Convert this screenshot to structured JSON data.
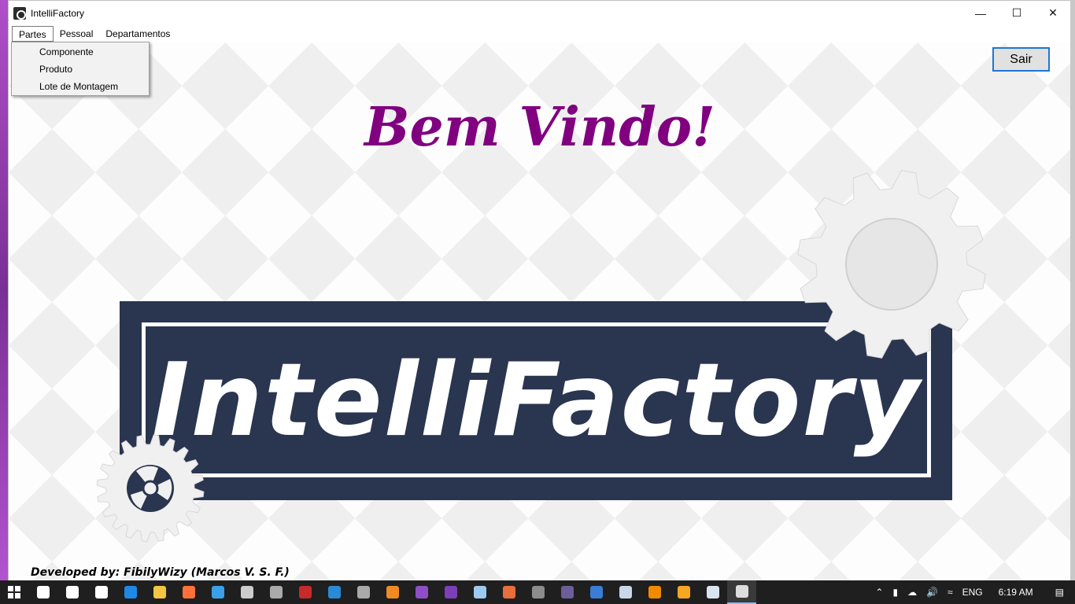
{
  "window": {
    "title": "IntelliFactory",
    "controls": [
      "minimize-icon",
      "maximize-icon",
      "close-icon"
    ]
  },
  "menubar": {
    "items": [
      {
        "label": "Partes",
        "active": true
      },
      {
        "label": "Pessoal"
      },
      {
        "label": "Departamentos"
      }
    ]
  },
  "dropdown": {
    "items": [
      "Componente",
      "Produto",
      "Lote de Montagem"
    ]
  },
  "main": {
    "welcome": "Bem Vindo!",
    "logo_text": "IntelliFactory",
    "exit_button": "Sair",
    "credit": "Developed by: FibilyWizy (Marcos V. S. F.)"
  },
  "taskbar": {
    "apps": [
      {
        "icon": "search-icon",
        "color": "#ffffff"
      },
      {
        "icon": "task-view-icon",
        "color": "#ffffff"
      },
      {
        "icon": "store-icon",
        "color": "#ffffff"
      },
      {
        "icon": "edge-icon",
        "color": "#1e88e5"
      },
      {
        "icon": "folder-icon",
        "color": "#f4c542"
      },
      {
        "icon": "firefox-icon",
        "color": "#ff7139"
      },
      {
        "icon": "ie-icon",
        "color": "#3aa0e8"
      },
      {
        "icon": "inkscape-icon",
        "color": "#cccccc"
      },
      {
        "icon": "eclipse-icon",
        "color": "#aaaaaa"
      },
      {
        "icon": "autocad-icon",
        "color": "#c72a2a"
      },
      {
        "icon": "vscode-icon",
        "color": "#2a8ad4"
      },
      {
        "icon": "db-icon",
        "color": "#aaaaaa"
      },
      {
        "icon": "box-icon",
        "color": "#f08a24"
      },
      {
        "icon": "vs-icon",
        "color": "#8e4fc6"
      },
      {
        "icon": "vs2-icon",
        "color": "#7c3fb8"
      },
      {
        "icon": "cube-icon",
        "color": "#9ccaf0"
      },
      {
        "icon": "people-icon",
        "color": "#e86f3c"
      },
      {
        "icon": "gimp-icon",
        "color": "#8c8c8c"
      },
      {
        "icon": "obs-icon",
        "color": "#6b5e9a"
      },
      {
        "icon": "media-icon",
        "color": "#3a7dd6"
      },
      {
        "icon": "notepad-icon",
        "color": "#c8d8e8"
      },
      {
        "icon": "vlc-icon",
        "color": "#f08a00"
      },
      {
        "icon": "player-icon",
        "color": "#f5a623"
      },
      {
        "icon": "doc-icon",
        "color": "#d8e4f0"
      },
      {
        "icon": "intellifactory-icon",
        "color": "#dddddd",
        "active": true
      }
    ],
    "tray": {
      "language": "ENG",
      "time": "6:19 AM"
    }
  }
}
